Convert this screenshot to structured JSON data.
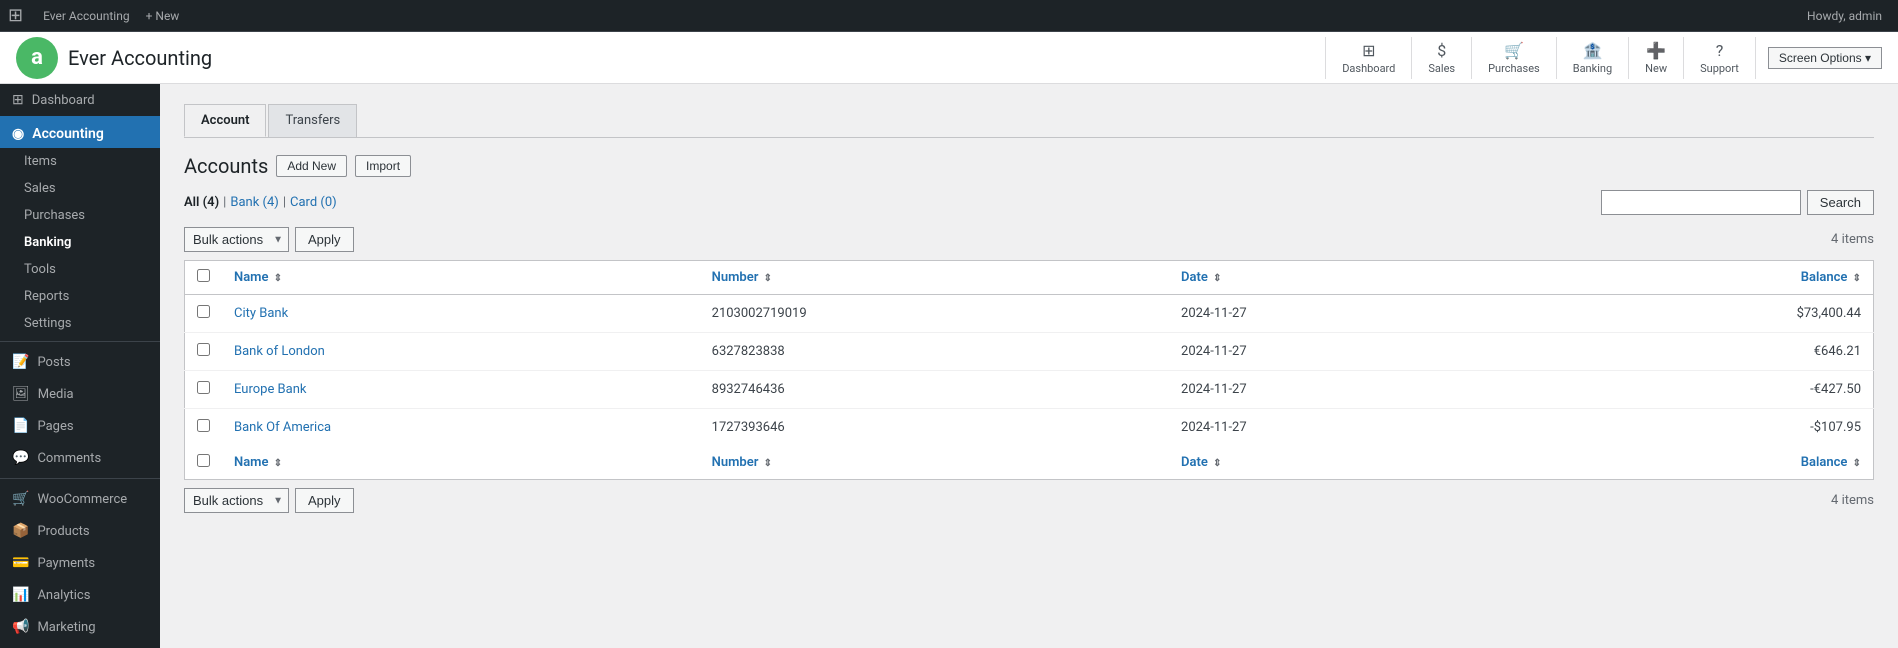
{
  "topbar": {
    "items": [
      {
        "label": "🏠",
        "name": "wp-home",
        "active": false
      },
      {
        "label": "Ever Accounting",
        "name": "plugin-name",
        "active": false
      },
      {
        "label": "+New",
        "name": "new-top",
        "active": false
      },
      {
        "label": "Howdy, admin",
        "name": "user-top",
        "active": false
      }
    ]
  },
  "plugin": {
    "title": "Ever Accounting",
    "nav": [
      {
        "label": "Dashboard",
        "icon": "⊞",
        "name": "nav-dashboard"
      },
      {
        "label": "Sales",
        "icon": "$",
        "name": "nav-sales"
      },
      {
        "label": "Purchases",
        "icon": "🛒",
        "name": "nav-purchases"
      },
      {
        "label": "Banking",
        "icon": "🏦",
        "name": "nav-banking"
      },
      {
        "label": "New",
        "icon": "+",
        "name": "nav-new"
      },
      {
        "label": "Support",
        "icon": "?",
        "name": "nav-support"
      }
    ],
    "screen_options": "Screen Options ▾"
  },
  "sidebar": {
    "sections": [
      {
        "label": "Dashboard",
        "icon": "⊞",
        "name": "dash",
        "active": false,
        "type": "item"
      },
      {
        "label": "Accounting",
        "icon": "◉",
        "name": "accounting",
        "active": true,
        "type": "header"
      },
      {
        "label": "Items",
        "icon": "",
        "name": "items",
        "active": false,
        "type": "sub"
      },
      {
        "label": "Sales",
        "icon": "",
        "name": "sales",
        "active": false,
        "type": "sub"
      },
      {
        "label": "Purchases",
        "icon": "",
        "name": "purchases",
        "active": false,
        "type": "sub"
      },
      {
        "label": "Banking",
        "icon": "",
        "name": "banking",
        "active": true,
        "type": "sub"
      },
      {
        "label": "Tools",
        "icon": "",
        "name": "tools",
        "active": false,
        "type": "sub"
      },
      {
        "label": "Reports",
        "icon": "",
        "name": "reports",
        "active": false,
        "type": "sub"
      },
      {
        "label": "Settings",
        "icon": "",
        "name": "settings",
        "active": false,
        "type": "sub"
      },
      {
        "type": "divider"
      },
      {
        "label": "Posts",
        "icon": "📝",
        "name": "posts",
        "active": false,
        "type": "item"
      },
      {
        "label": "Media",
        "icon": "🖼",
        "name": "media",
        "active": false,
        "type": "item"
      },
      {
        "label": "Pages",
        "icon": "📄",
        "name": "pages",
        "active": false,
        "type": "item"
      },
      {
        "label": "Comments",
        "icon": "💬",
        "name": "comments",
        "active": false,
        "type": "item"
      },
      {
        "type": "divider"
      },
      {
        "label": "WooCommerce",
        "icon": "🛒",
        "name": "woocommerce",
        "active": false,
        "type": "item"
      },
      {
        "label": "Products",
        "icon": "📦",
        "name": "products",
        "active": false,
        "type": "item"
      },
      {
        "label": "Payments",
        "icon": "💳",
        "name": "payments",
        "active": false,
        "type": "item"
      },
      {
        "label": "Analytics",
        "icon": "📊",
        "name": "analytics",
        "active": false,
        "type": "item"
      },
      {
        "label": "Marketing",
        "icon": "📢",
        "name": "marketing",
        "active": false,
        "type": "item"
      }
    ]
  },
  "content": {
    "tabs": [
      {
        "label": "Account",
        "active": true
      },
      {
        "label": "Transfers",
        "active": false
      }
    ],
    "page_title": "Accounts",
    "btn_add_new": "Add New",
    "btn_import": "Import",
    "filters": [
      {
        "label": "All (4)",
        "key": "all",
        "active": true
      },
      {
        "label": "Bank (4)",
        "key": "bank",
        "active": false
      },
      {
        "label": "Card (0)",
        "key": "card",
        "active": false
      }
    ],
    "search_placeholder": "",
    "btn_search": "Search",
    "bulk_actions_label": "Bulk actions",
    "btn_apply_top": "Apply",
    "btn_apply_bottom": "Apply",
    "items_count_top": "4 items",
    "items_count_bottom": "4 items",
    "table": {
      "columns": [
        {
          "label": "Name",
          "key": "name",
          "sortable": true
        },
        {
          "label": "Number",
          "key": "number",
          "sortable": true
        },
        {
          "label": "Date",
          "key": "date",
          "sortable": true
        },
        {
          "label": "Balance",
          "key": "balance",
          "sortable": true
        }
      ],
      "rows": [
        {
          "name": "City Bank",
          "number": "2103002719019",
          "date": "2024-11-27",
          "balance": "$73,400.44"
        },
        {
          "name": "Bank of London",
          "number": "6327823838",
          "date": "2024-11-27",
          "balance": "€646.21"
        },
        {
          "name": "Europe Bank",
          "number": "8932746436",
          "date": "2024-11-27",
          "balance": "-€427.50"
        },
        {
          "name": "Bank Of America",
          "number": "1727393646",
          "date": "2024-11-27",
          "balance": "-$107.95"
        }
      ]
    }
  },
  "colors": {
    "accent": "#2271b1",
    "sidebar_bg": "#1d2327",
    "sidebar_active": "#2271b1",
    "positive": "#1d2327",
    "negative": "#1d2327"
  }
}
